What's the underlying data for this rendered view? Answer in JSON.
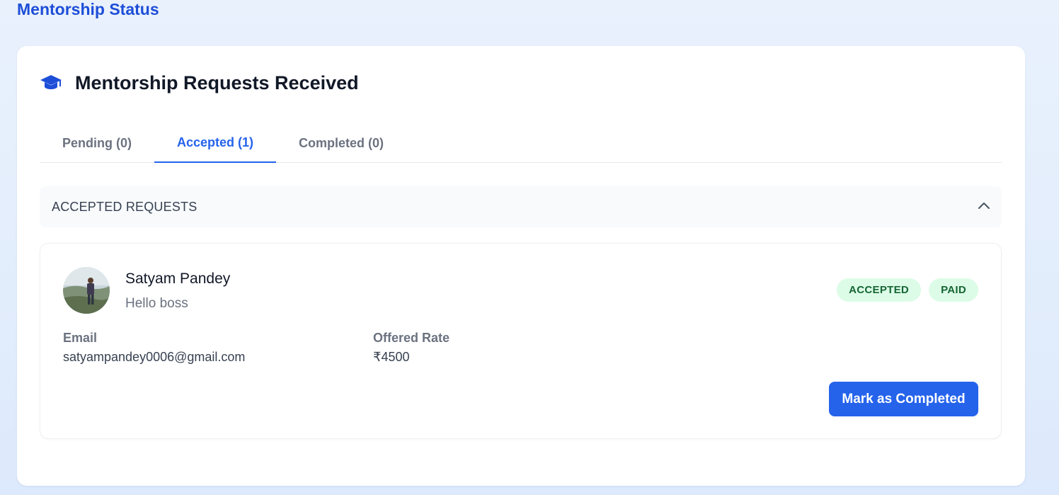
{
  "page": {
    "title": "Mentorship Status"
  },
  "card": {
    "icon": "graduation-cap-icon",
    "title": "Mentorship Requests Received"
  },
  "tabs": [
    {
      "label": "Pending (0)",
      "active": false
    },
    {
      "label": "Accepted (1)",
      "active": true
    },
    {
      "label": "Completed (0)",
      "active": false
    }
  ],
  "section": {
    "title": "ACCEPTED REQUESTS",
    "toggle_icon": "chevron-up-icon",
    "expanded": true
  },
  "requests": [
    {
      "name": "Satyam Pandey",
      "message": "Hello boss",
      "avatar": "profile-photo",
      "badges": [
        "ACCEPTED",
        "PAID"
      ],
      "email_label": "Email",
      "email": "satyampandey0006@gmail.com",
      "rate_label": "Offered Rate",
      "rate": "₹4500",
      "action_label": "Mark as Completed"
    }
  ],
  "colors": {
    "accent": "#2563eb",
    "heading": "#1d4ed8",
    "badge_bg": "#dcfce7",
    "badge_text": "#166534"
  }
}
